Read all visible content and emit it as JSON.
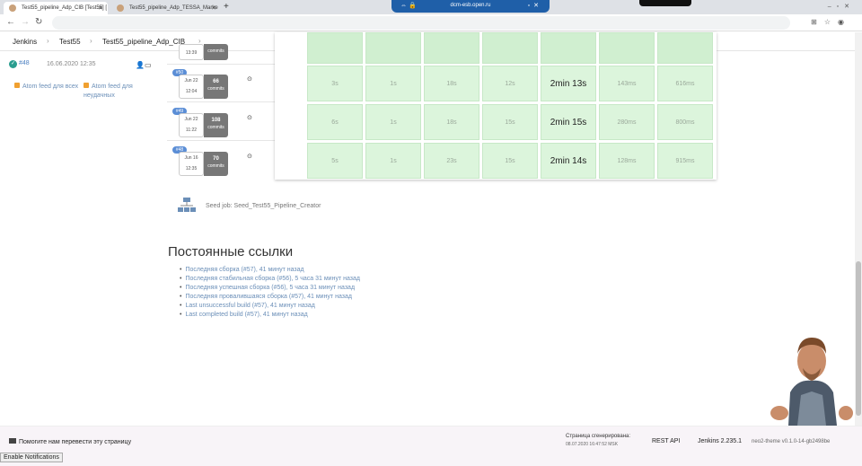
{
  "browser": {
    "tabs": [
      {
        "title": "Test55_pipeline_Adp_CIB [Test55] ["
      },
      {
        "title": "Test55_pipeline_Adp_TESSA_Marke"
      }
    ],
    "remote_host": "dcm-esb.open.ru"
  },
  "breadcrumbs": [
    "Jenkins",
    "Test55",
    "Test55_pipeline_Adp_CIB"
  ],
  "sidebar": {
    "build_number": "#48",
    "build_date": "16.06.2020 12:35",
    "atom_all": "Atom feed для всех",
    "atom_failed": "Atom feed для неудачных"
  },
  "builds": [
    {
      "badge": "#50",
      "date": "Jun 22",
      "time": "12:04",
      "commits": "66",
      "commits_label": "commits",
      "cells": [
        "3s",
        "1s",
        "18s",
        "12s",
        "2min 13s",
        "143ms",
        "616ms"
      ]
    },
    {
      "badge": "#49",
      "date": "Jun 22",
      "time": "11:22",
      "commits": "108",
      "commits_label": "commits",
      "cells": [
        "6s",
        "1s",
        "18s",
        "15s",
        "2min 15s",
        "280ms",
        "800ms"
      ]
    },
    {
      "badge": "#48",
      "date": "Jun 16",
      "time": "12:35",
      "commits": "70",
      "commits_label": "commits",
      "cells": [
        "5s",
        "1s",
        "23s",
        "15s",
        "2min 14s",
        "128ms",
        "915ms"
      ]
    }
  ],
  "top_partial_time": "13:39",
  "top_partial_label": "commits",
  "seed_job": "Seed job: Seed_Test55_Pipeline_Creator",
  "permalinks_title": "Постоянные ссылки",
  "permalinks": [
    "Последняя сборка (#57), 41 минут назад",
    "Последняя стабильная сборка (#56), 5 часа 31 минут назад",
    "Последняя успешная сборка (#56), 5 часа 31 минут назад",
    "Последняя провалившаяся сборка (#57), 41 минут назад",
    "Last unsuccessful build (#57), 41 минут назад",
    "Last completed build (#57), 41 минут назад"
  ],
  "footer": {
    "translate": "Помогите нам перевести эту страницу",
    "generated_label": "Страница сгенерирована:",
    "generated_time": "08.07.2020 16:47:52 MSK",
    "rest_api": "REST API",
    "version": "Jenkins 2.235.1",
    "theme": "neo2-theme v0.1.0-14-gb2498be"
  },
  "notifications_button": "Enable Notifications"
}
